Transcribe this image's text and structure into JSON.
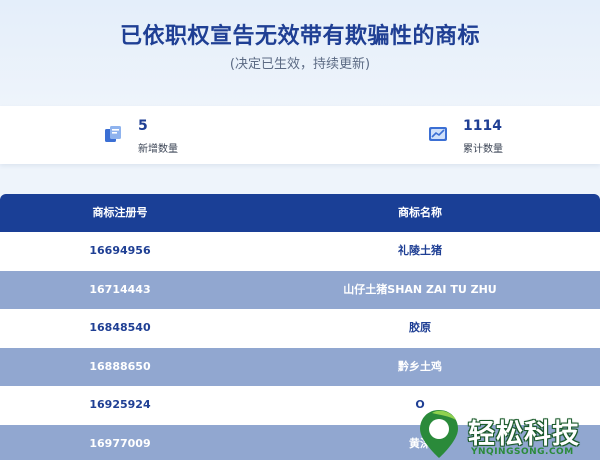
{
  "header": {
    "title": "已依职权宣告无效带有欺骗性的商标",
    "subtitle": "(决定已生效，持续更新)"
  },
  "stats": {
    "new": {
      "value": "5",
      "label": "新增数量",
      "icon": "new-document-icon"
    },
    "total": {
      "value": "1114",
      "label": "累计数量",
      "icon": "chart-icon"
    }
  },
  "table": {
    "headers": [
      "商标注册号",
      "商标名称"
    ],
    "rows": [
      [
        "16694956",
        "礼陵土猪"
      ],
      [
        "16714443",
        "山仔土猪SHAN ZAI TU ZHU"
      ],
      [
        "16848540",
        "胶原"
      ],
      [
        "16888650",
        "黔乡土鸡"
      ],
      [
        "16925924",
        "O"
      ],
      [
        "16977009",
        "黄深"
      ]
    ]
  },
  "watermark": {
    "text": "轻松科技",
    "sub": "YNQINGSONG.COM"
  },
  "colors": {
    "primary": "#1a3f96",
    "title": "#1f3f94",
    "stripe": "#91a7d0",
    "background": "#eef4fb"
  }
}
